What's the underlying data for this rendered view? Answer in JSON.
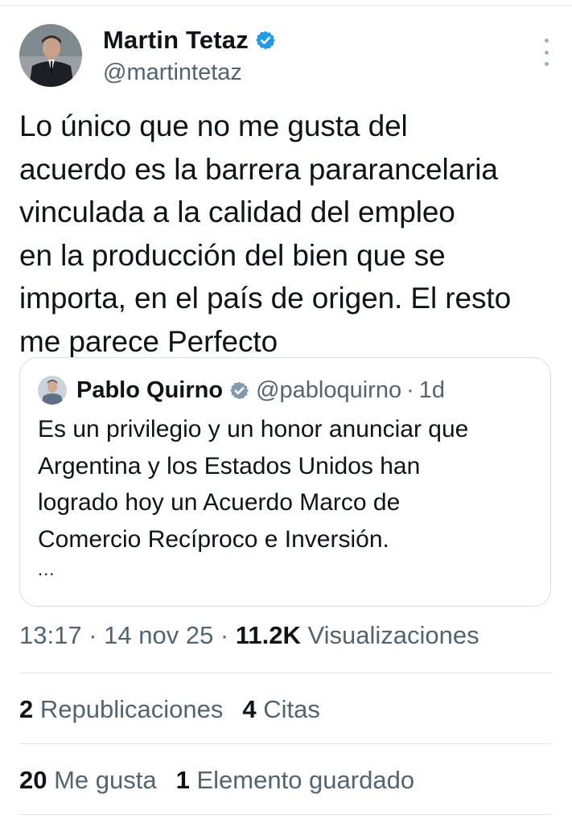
{
  "author": {
    "name": "Martin Tetaz",
    "handle": "@martintetaz",
    "verified_color": "#1d9bf0",
    "avatar_icon": "profile-photo"
  },
  "tweet": {
    "lines": [
      "Lo único que no me gusta del",
      "acuerdo es la barrera pararancelaria",
      "vinculada a la calidad del empleo",
      "en la producción del bien que se",
      "importa, en el país de origen. El resto",
      "me parece Perfecto"
    ]
  },
  "quote": {
    "name": "Pablo Quirno",
    "handle": "@pabloquirno",
    "separator": "·",
    "time": "1d",
    "verified_color": "#829aab",
    "lines": [
      "Es un privilegio y un honor anunciar que",
      "Argentina y los Estados Unidos han",
      "logrado hoy un Acuerdo Marco de",
      "Comercio Recíproco e Inversión."
    ],
    "ellipsis": "..."
  },
  "meta": {
    "time": "13:17",
    "sep1": " · ",
    "date": "14 nov 25",
    "sep2": " · ",
    "views": "11.2K",
    "views_label": " Visualizaciones"
  },
  "stats": {
    "reposts": "2",
    "reposts_label": " Republicaciones",
    "quotes": "4",
    "quotes_label": " Citas",
    "likes": "20",
    "likes_label": " Me gusta",
    "bookmarks": "1",
    "bookmarks_label": " Elemento guardado"
  }
}
